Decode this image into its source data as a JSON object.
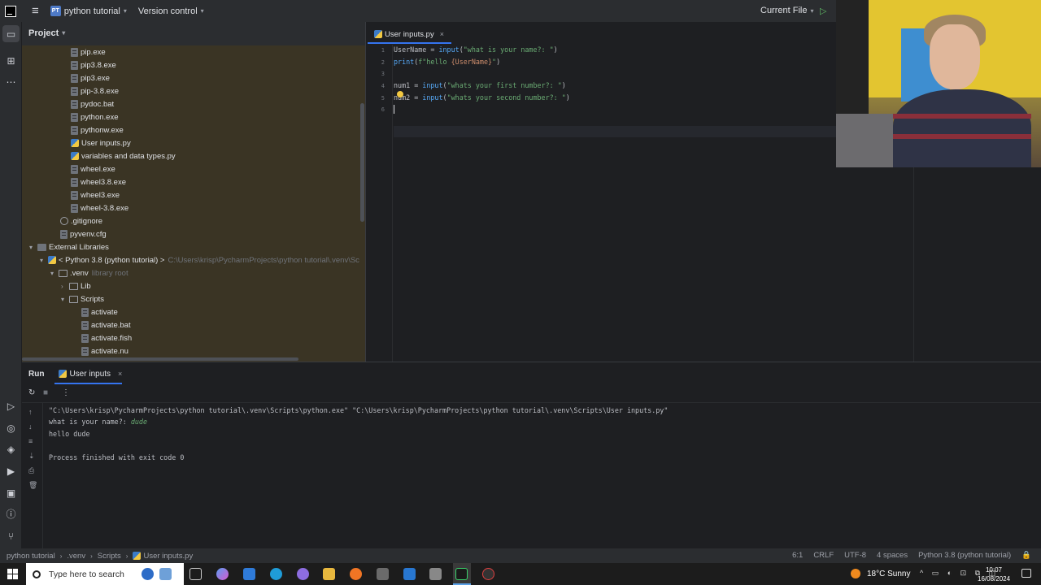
{
  "titlebar": {
    "menu_icon": "hamburger-icon",
    "project_badge": "PT",
    "project_name": "python tutorial",
    "vcs_label": "Version control",
    "run_config": "Current File"
  },
  "project_panel": {
    "title": "Project",
    "tree": [
      {
        "label": "pip.exe",
        "type": "file"
      },
      {
        "label": "pip3.8.exe",
        "type": "file"
      },
      {
        "label": "pip3.exe",
        "type": "file"
      },
      {
        "label": "pip-3.8.exe",
        "type": "file"
      },
      {
        "label": "pydoc.bat",
        "type": "file"
      },
      {
        "label": "python.exe",
        "type": "file"
      },
      {
        "label": "pythonw.exe",
        "type": "file"
      },
      {
        "label": "User inputs.py",
        "type": "python"
      },
      {
        "label": "variables and data types.py",
        "type": "python"
      },
      {
        "label": "wheel.exe",
        "type": "file"
      },
      {
        "label": "wheel3.8.exe",
        "type": "file"
      },
      {
        "label": "wheel3.exe",
        "type": "file"
      },
      {
        "label": "wheel-3.8.exe",
        "type": "file"
      },
      {
        "label": ".gitignore",
        "type": "ignore"
      },
      {
        "label": "pyvenv.cfg",
        "type": "file"
      },
      {
        "label": "External Libraries",
        "type": "lib"
      },
      {
        "label": "< Python 3.8 (python tutorial) >",
        "hint": "C:\\Users\\krisp\\PycharmProjects\\python tutorial\\.venv\\Sc",
        "type": "python"
      },
      {
        "label": ".venv",
        "hint": "library root",
        "type": "folder"
      },
      {
        "label": "Lib",
        "type": "folder"
      },
      {
        "label": "Scripts",
        "type": "folder"
      },
      {
        "label": "activate",
        "type": "file"
      },
      {
        "label": "activate.bat",
        "type": "file"
      },
      {
        "label": "activate.fish",
        "type": "file"
      },
      {
        "label": "activate.nu",
        "type": "file"
      }
    ]
  },
  "editor": {
    "tab_label": "User inputs.py",
    "line_numbers": [
      "1",
      "2",
      "3",
      "4",
      "5",
      "6"
    ],
    "lines": {
      "l1_a": "UserName = ",
      "l1_b": "input",
      "l1_c": "(",
      "l1_d": "\"what is your name?: \"",
      "l1_e": ")",
      "l2_a": "print",
      "l2_b": "(",
      "l2_c": "f\"hello ",
      "l2_d": "{UserName}",
      "l2_e": "\"",
      "l2_f": ")",
      "l4_a": "num1 = ",
      "l4_b": "input",
      "l4_c": "(",
      "l4_d": "\"whats your first number?: \"",
      "l4_e": ")",
      "l5_a": "num2 = ",
      "l5_b": "input",
      "l5_c": "(",
      "l5_d": "\"whats your second number?: \"",
      "l5_e": ")"
    }
  },
  "run_panel": {
    "title": "Run",
    "tab_label": "User inputs",
    "output": {
      "command": "\"C:\\Users\\krisp\\PycharmProjects\\python tutorial\\.venv\\Scripts\\python.exe\" \"C:\\Users\\krisp\\PycharmProjects\\python tutorial\\.venv\\Scripts\\User inputs.py\"",
      "prompt": "what is your name?: ",
      "user_input": "dude",
      "hello": "hello dude",
      "finished": "Process finished with exit code 0"
    }
  },
  "statusbar": {
    "crumbs": [
      "python tutorial",
      ".venv",
      "Scripts",
      "User inputs.py"
    ],
    "position": "6:1",
    "line_sep": "CRLF",
    "encoding": "UTF-8",
    "indent": "4 spaces",
    "interpreter": "Python 3.8 (python tutorial)"
  },
  "taskbar": {
    "search_placeholder": "Type here to search",
    "weather": "18°C  Sunny",
    "time": "10:07",
    "date": "16/08/2024"
  }
}
